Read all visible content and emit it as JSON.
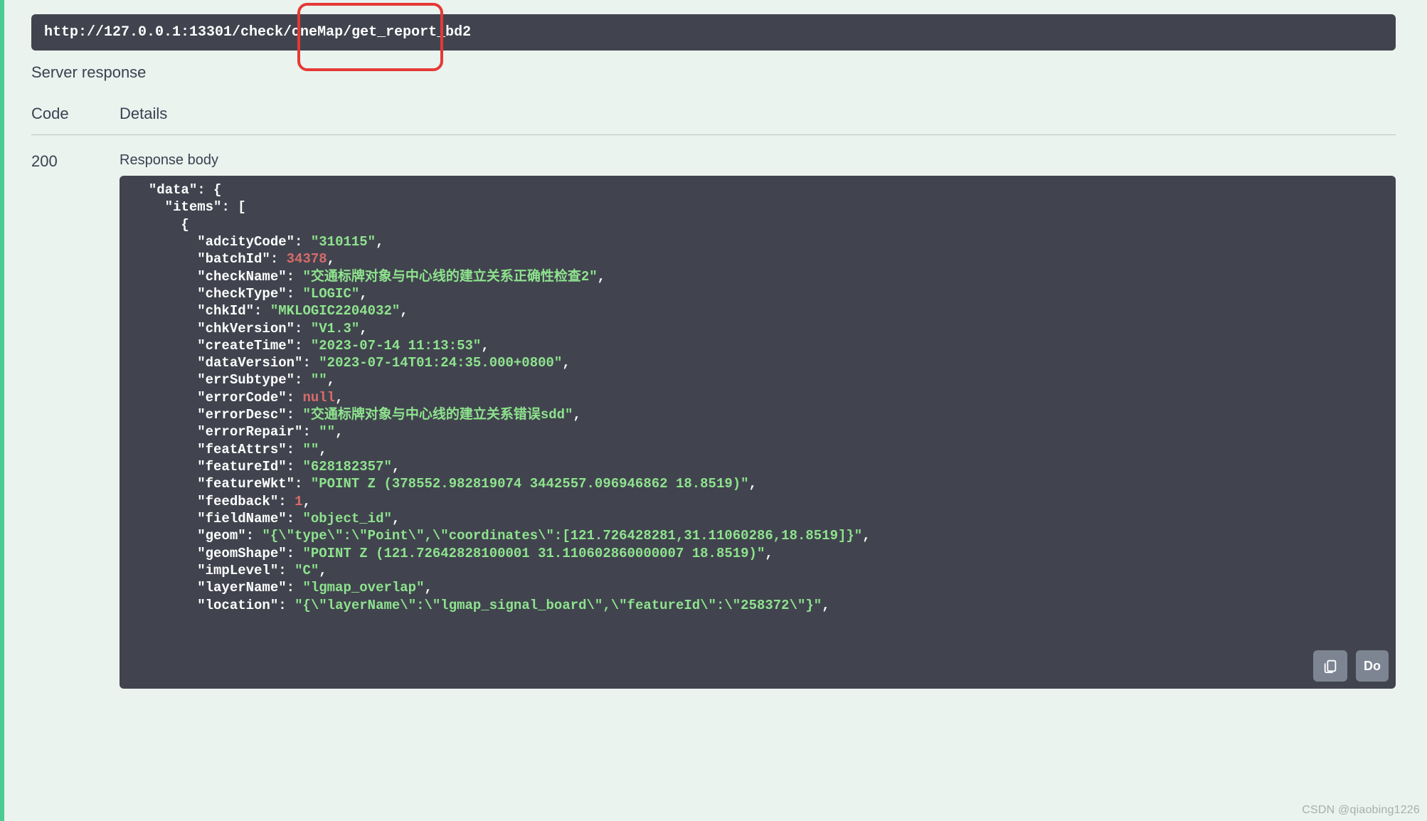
{
  "request": {
    "url": "http://127.0.0.1:13301/check/oneMap/get_report_bd2"
  },
  "labels": {
    "serverResponse": "Server response",
    "code": "Code",
    "details": "Details",
    "responseBody": "Response body",
    "download": "Do"
  },
  "response": {
    "statusCode": "200",
    "body": {
      "data": {
        "items": [
          {
            "adcityCode": "310115",
            "batchId": 34378,
            "checkName": "交通标牌对象与中心线的建立关系正确性检查2",
            "checkType": "LOGIC",
            "chkId": "MKLOGIC2204032",
            "chkVersion": "V1.3",
            "createTime": "2023-07-14 11:13:53",
            "dataVersion": "2023-07-14T01:24:35.000+0800",
            "errSubtype": "",
            "errorCode": null,
            "errorDesc": "交通标牌对象与中心线的建立关系错误sdd",
            "errorRepair": "",
            "featAttrs": "",
            "featureId": "628182357",
            "featureWkt": "POINT Z (378552.982819074 3442557.096946862 18.8519)",
            "feedback": 1,
            "fieldName": "object_id",
            "geom": "{\"type\":\"Point\",\"coordinates\":[121.726428281,31.11060286,18.8519]}",
            "geomShape": "POINT Z (121.72642828100001 31.110602860000007 18.8519)",
            "impLevel": "C",
            "layerName": "lgmap_overlap",
            "location": "{\"layerName\":\"lgmap_signal_board\",\"featureId\":\"258372\"}"
          }
        ]
      }
    }
  },
  "watermark": "CSDN @qiaobing1226"
}
